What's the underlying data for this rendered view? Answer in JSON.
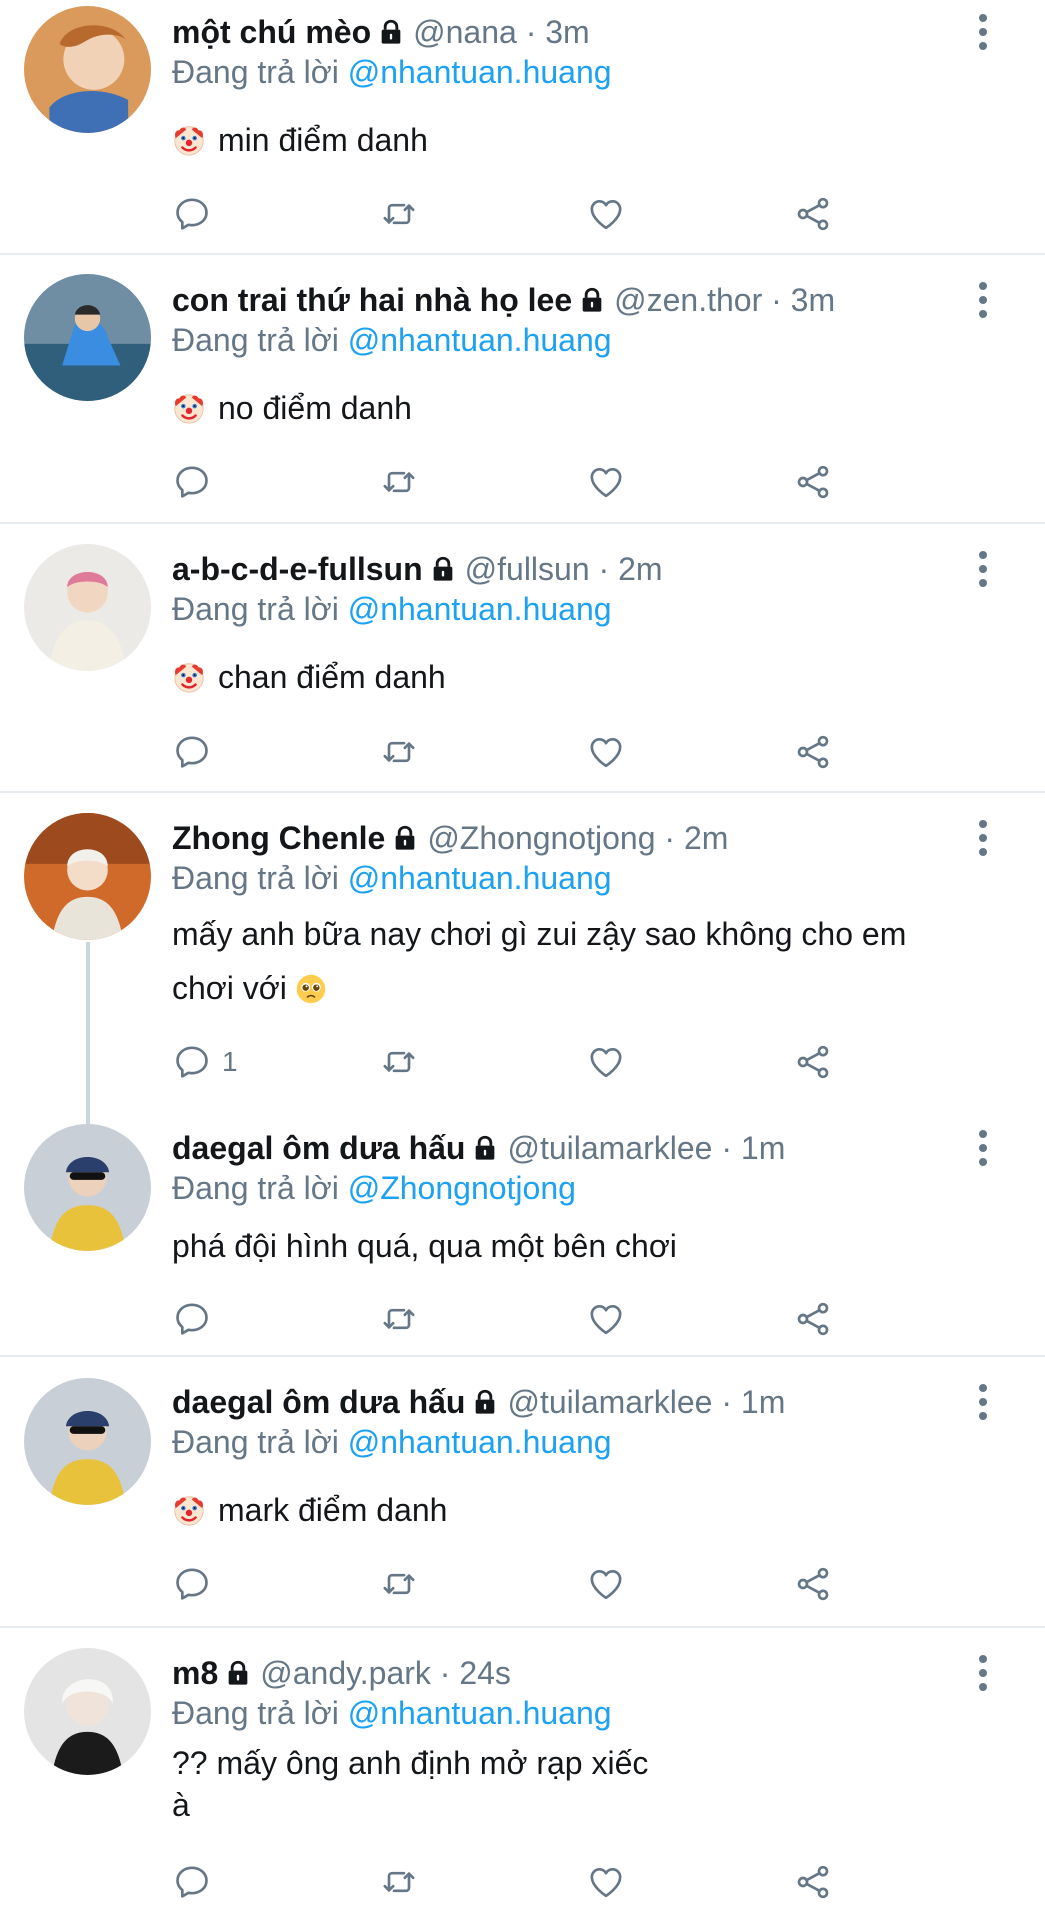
{
  "reply_prefix": "Đang trả lời",
  "tweets": [
    {
      "name": "một chú mèo",
      "handle": "@nana",
      "sep": "·",
      "time": "3m",
      "reply_to": "@nhantuan.huang",
      "emoji": "clown-face",
      "text": "min điểm danh",
      "reply_count": ""
    },
    {
      "name": "con trai thứ hai nhà họ lee",
      "handle": "@zen.thor",
      "sep": "·",
      "time": "3m",
      "reply_to": "@nhantuan.huang",
      "emoji": "clown-face",
      "text": "no điểm danh",
      "reply_count": ""
    },
    {
      "name": "a-b-c-d-e-fullsun",
      "handle": "@fullsun",
      "sep": "·",
      "time": "2m",
      "reply_to": "@nhantuan.huang",
      "emoji": "clown-face",
      "text": "chan điểm danh",
      "reply_count": ""
    },
    {
      "name": "Zhong Chenle",
      "handle": "@Zhongnotjong",
      "sep": "·",
      "time": "2m",
      "reply_to": "@nhantuan.huang",
      "emoji": "",
      "text_line1": "mấy anh bữa nay chơi gì zui zậy sao không cho em",
      "text_line2": "chơi với",
      "trailing_emoji": "pleading-face",
      "reply_count": "1"
    },
    {
      "name": "daegal ôm dưa hấu",
      "handle": "@tuilamarklee",
      "sep": "·",
      "time": "1m",
      "reply_to": "@Zhongnotjong",
      "emoji": "",
      "text": "phá đội hình quá, qua một bên chơi",
      "reply_count": ""
    },
    {
      "name": "daegal ôm dưa hấu",
      "handle": "@tuilamarklee",
      "sep": "·",
      "time": "1m",
      "reply_to": "@nhantuan.huang",
      "emoji": "clown-face",
      "text": "mark điểm danh",
      "reply_count": ""
    },
    {
      "name": "m8",
      "handle": "@andy.park",
      "sep": "·",
      "time": "24s",
      "reply_to": "@nhantuan.huang",
      "emoji": "",
      "text_line1": "?? mấy ông anh định mở rạp xiếc",
      "text_line2": "à",
      "reply_count": ""
    }
  ],
  "icons": {
    "reply": "speech-bubble-icon",
    "retweet": "retweet-icon",
    "like": "heart-icon",
    "share": "share-icon",
    "more": "more-vertical-icon",
    "lock": "lock-icon"
  },
  "colors": {
    "link": "#1da1f2",
    "muted": "#657786",
    "text": "#14171a",
    "divider": "#e6ecf0"
  }
}
